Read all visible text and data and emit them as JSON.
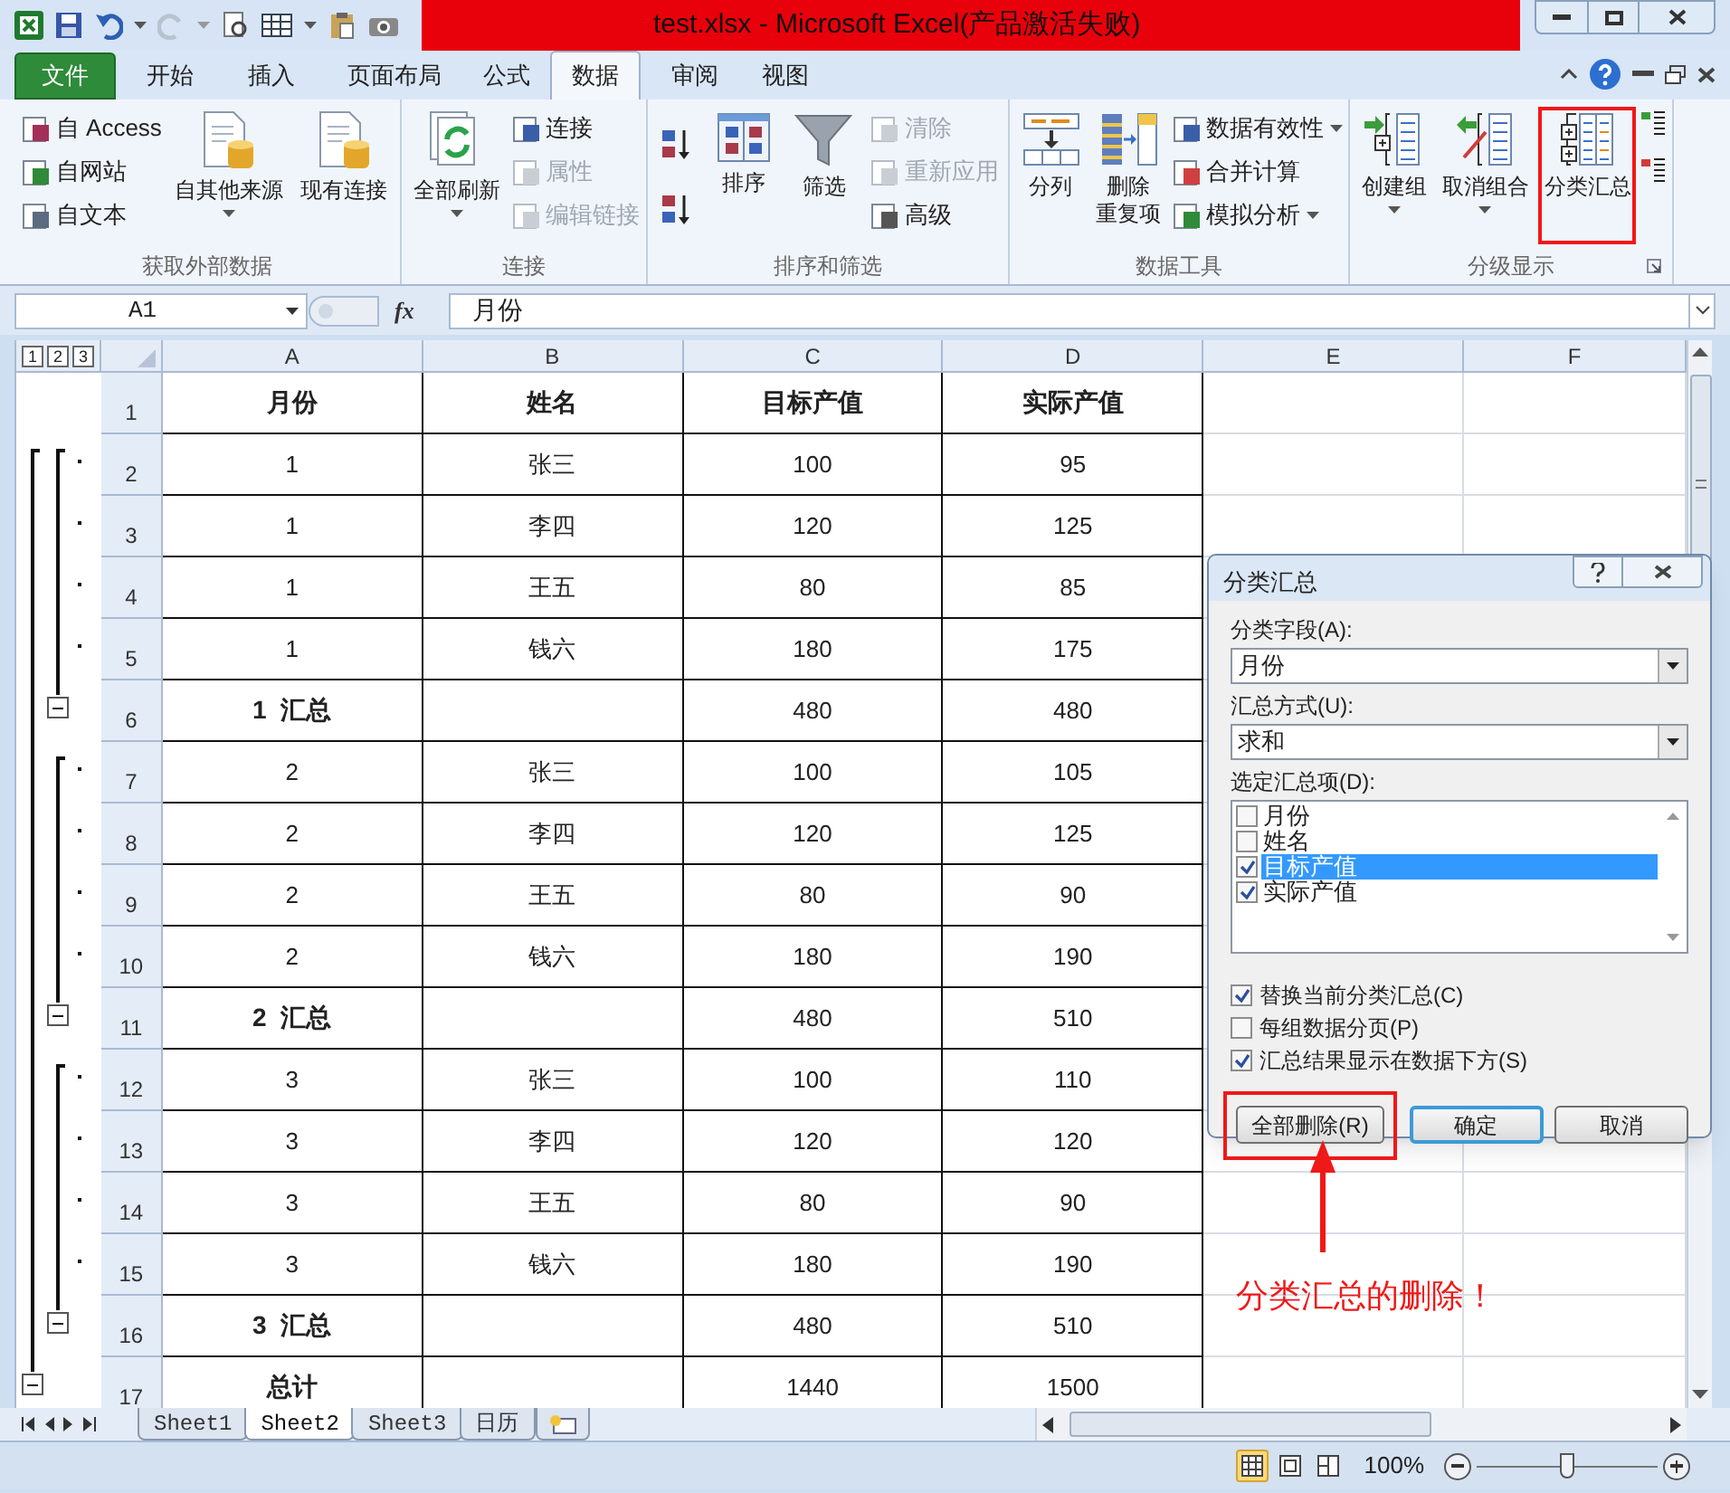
{
  "window": {
    "title": "test.xlsx  -  Microsoft Excel(产品激活失败)"
  },
  "ribbon_tabs": [
    {
      "label": "文件",
      "kind": "file",
      "selected": false
    },
    {
      "label": "开始",
      "kind": "tab",
      "selected": false
    },
    {
      "label": "插入",
      "kind": "tab",
      "selected": false
    },
    {
      "label": "页面布局",
      "kind": "tab",
      "selected": false
    },
    {
      "label": "公式",
      "kind": "tab",
      "selected": false
    },
    {
      "label": "数据",
      "kind": "tab",
      "selected": true
    },
    {
      "label": "审阅",
      "kind": "tab",
      "selected": false
    },
    {
      "label": "视图",
      "kind": "tab",
      "selected": false
    }
  ],
  "ribbon_groups": [
    {
      "label": "获取外部数据",
      "items": [
        {
          "kind": "stack",
          "items": [
            {
              "label": "自 Access",
              "disabled": false,
              "dropdown": false
            },
            {
              "label": "自网站",
              "disabled": false,
              "dropdown": false
            },
            {
              "label": "自文本",
              "disabled": false,
              "dropdown": false
            }
          ]
        },
        {
          "kind": "large",
          "label": "自其他来源",
          "dropdown": true,
          "highlighted": false
        },
        {
          "kind": "large",
          "label": "现有连接",
          "dropdown": false,
          "highlighted": false
        }
      ]
    },
    {
      "label": "连接",
      "items": [
        {
          "kind": "large",
          "label": "全部刷新",
          "dropdown": true,
          "highlighted": false
        },
        {
          "kind": "stack",
          "items": [
            {
              "label": "连接",
              "disabled": false,
              "dropdown": false
            },
            {
              "label": "属性",
              "disabled": true,
              "dropdown": false
            },
            {
              "label": "编辑链接",
              "disabled": true,
              "dropdown": false
            }
          ]
        }
      ]
    },
    {
      "label": "排序和筛选",
      "items": [
        {
          "kind": "sort_buttons"
        },
        {
          "kind": "large",
          "label": "排序",
          "dropdown": false,
          "highlighted": false
        },
        {
          "kind": "large",
          "label": "筛选",
          "dropdown": false,
          "highlighted": false
        },
        {
          "kind": "stack",
          "items": [
            {
              "label": "清除",
              "disabled": true,
              "dropdown": false
            },
            {
              "label": "重新应用",
              "disabled": true,
              "dropdown": false
            },
            {
              "label": "高级",
              "disabled": false,
              "dropdown": false
            }
          ]
        }
      ]
    },
    {
      "label": "数据工具",
      "items": [
        {
          "kind": "large",
          "label": "分列",
          "dropdown": false,
          "highlighted": false
        },
        {
          "kind": "large",
          "label_lines": [
            "删除",
            "重复项"
          ],
          "dropdown": false,
          "highlighted": false
        },
        {
          "kind": "stack",
          "items": [
            {
              "label": "数据有效性",
              "disabled": false,
              "dropdown": true
            },
            {
              "label": "合并计算",
              "disabled": false,
              "dropdown": false
            },
            {
              "label": "模拟分析",
              "disabled": false,
              "dropdown": true
            }
          ]
        }
      ]
    },
    {
      "label": "分级显示",
      "items": [
        {
          "kind": "large",
          "label": "创建组",
          "dropdown": true,
          "highlighted": false
        },
        {
          "kind": "large",
          "label": "取消组合",
          "dropdown": true,
          "highlighted": false
        },
        {
          "kind": "large",
          "label": "分类汇总",
          "dropdown": false,
          "highlighted": true
        },
        {
          "kind": "detail_buttons"
        }
      ]
    }
  ],
  "formula_bar": {
    "name_box": "A1",
    "function_label": "fx",
    "value": "月份"
  },
  "outline_levels": [
    "1",
    "2",
    "3"
  ],
  "columns": [
    "A",
    "B",
    "C",
    "D",
    "E",
    "F"
  ],
  "rows": [
    {
      "number": "1",
      "kind": "header",
      "cells": [
        "月份",
        "姓名",
        "目标产值",
        "实际产值"
      ]
    },
    {
      "number": "2",
      "kind": "detail",
      "cells": [
        "1",
        "张三",
        "100",
        "95"
      ]
    },
    {
      "number": "3",
      "kind": "detail",
      "cells": [
        "1",
        "李四",
        "120",
        "125"
      ]
    },
    {
      "number": "4",
      "kind": "detail",
      "cells": [
        "1",
        "王五",
        "80",
        "85"
      ]
    },
    {
      "number": "5",
      "kind": "detail",
      "cells": [
        "1",
        "钱六",
        "180",
        "175"
      ]
    },
    {
      "number": "6",
      "kind": "subtotal",
      "cells": [
        "1  汇总",
        "480",
        "480"
      ]
    },
    {
      "number": "7",
      "kind": "detail",
      "cells": [
        "2",
        "张三",
        "100",
        "105"
      ]
    },
    {
      "number": "8",
      "kind": "detail",
      "cells": [
        "2",
        "李四",
        "120",
        "125"
      ]
    },
    {
      "number": "9",
      "kind": "detail",
      "cells": [
        "2",
        "王五",
        "80",
        "90"
      ]
    },
    {
      "number": "10",
      "kind": "detail",
      "cells": [
        "2",
        "钱六",
        "180",
        "190"
      ]
    },
    {
      "number": "11",
      "kind": "subtotal",
      "cells": [
        "2  汇总",
        "480",
        "510"
      ]
    },
    {
      "number": "12",
      "kind": "detail",
      "cells": [
        "3",
        "张三",
        "100",
        "110"
      ]
    },
    {
      "number": "13",
      "kind": "detail",
      "cells": [
        "3",
        "李四",
        "120",
        "120"
      ]
    },
    {
      "number": "14",
      "kind": "detail",
      "cells": [
        "3",
        "王五",
        "80",
        "90"
      ]
    },
    {
      "number": "15",
      "kind": "detail",
      "cells": [
        "3",
        "钱六",
        "180",
        "190"
      ]
    },
    {
      "number": "16",
      "kind": "subtotal",
      "cells": [
        "3  汇总",
        "480",
        "510"
      ]
    },
    {
      "number": "17",
      "kind": "total",
      "cells": [
        "总计",
        "1440",
        "1500"
      ]
    }
  ],
  "dialog": {
    "title": "分类汇总",
    "fields": [
      {
        "label": "分类字段(A):",
        "value": "月份"
      },
      {
        "label": "汇总方式(U):",
        "value": "求和"
      }
    ],
    "list_label": "选定汇总项(D):",
    "list_items": [
      {
        "label": "月份",
        "checked": false,
        "selected": false
      },
      {
        "label": "姓名",
        "checked": false,
        "selected": false
      },
      {
        "label": "目标产值",
        "checked": true,
        "selected": true
      },
      {
        "label": "实际产值",
        "checked": true,
        "selected": false
      }
    ],
    "options": [
      {
        "label": "替换当前分类汇总(C)",
        "checked": true
      },
      {
        "label": "每组数据分页(P)",
        "checked": false
      },
      {
        "label": "汇总结果显示在数据下方(S)",
        "checked": true
      }
    ],
    "buttons": [
      {
        "label": "全部删除(R)",
        "default": false,
        "highlighted": true
      },
      {
        "label": "确定",
        "default": true,
        "highlighted": false
      },
      {
        "label": "取消",
        "default": false,
        "highlighted": false
      }
    ]
  },
  "annotation": {
    "text": "分类汇总的删除！"
  },
  "sheet_tabs": [
    {
      "label": "Sheet1",
      "selected": false
    },
    {
      "label": "Sheet2",
      "selected": true
    },
    {
      "label": "Sheet3",
      "selected": false
    },
    {
      "label": "日历",
      "selected": false
    }
  ],
  "status_bar": {
    "views": [
      {
        "selected": true
      },
      {
        "selected": false
      },
      {
        "selected": false
      }
    ],
    "zoom": {
      "reading": "100%",
      "level": 0.5
    }
  }
}
